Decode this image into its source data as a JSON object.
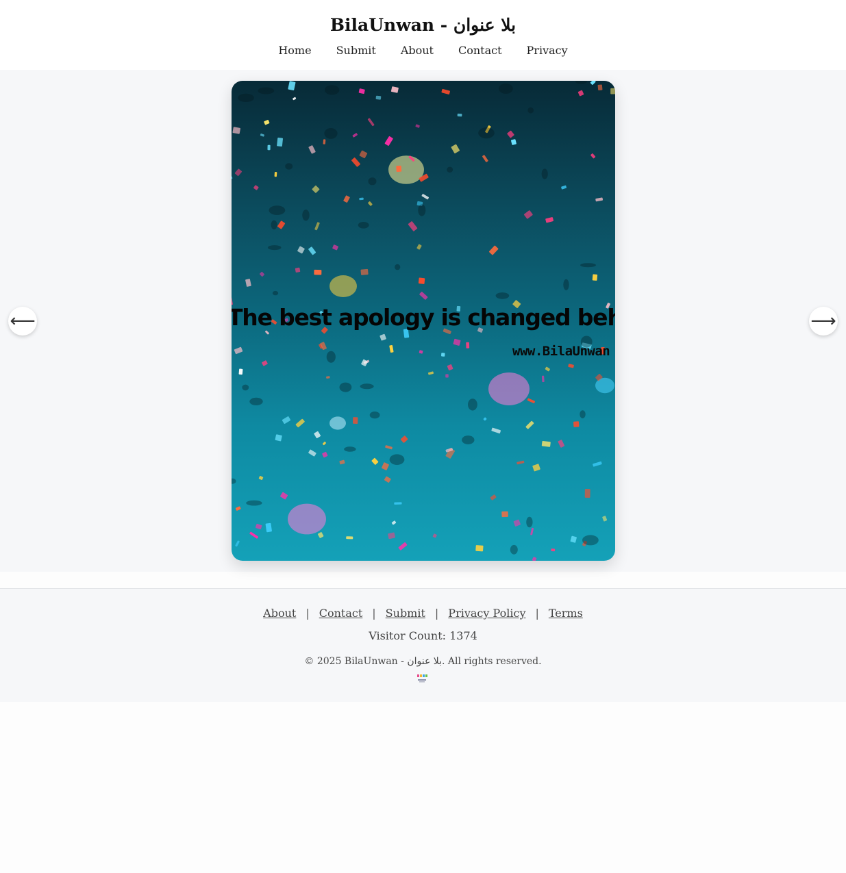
{
  "header": {
    "site_title": "BilaUnwan - بلا عنوان",
    "nav": [
      "Home",
      "Submit",
      "About",
      "Contact",
      "Privacy"
    ]
  },
  "slider": {
    "quote_text": "The best apology is changed behavior",
    "watermark_text": "www.BilaUnwan",
    "prev_glyph": "⟵",
    "next_glyph": "⟶"
  },
  "footer": {
    "links": [
      "About",
      "Contact",
      "Submit",
      "Privacy Policy",
      "Terms"
    ],
    "separator": "|",
    "visitor_count": "Visitor Count: 1374",
    "copyright": "© 2025 BilaUnwan - بلا عنوان. All rights reserved."
  },
  "colors": {
    "slide_top": "#072a37",
    "slide_bottom": "#14a1b8",
    "page_bg": "#f6f7f9"
  }
}
